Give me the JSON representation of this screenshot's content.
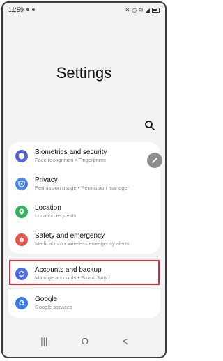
{
  "status_bar": {
    "time": "11:59"
  },
  "page": {
    "title": "Settings"
  },
  "rows": [
    {
      "title": "Biometrics and security",
      "subtitle": "Face recognition  •  Fingerprints",
      "icon": "shield-icon",
      "color": "#5563d9"
    },
    {
      "title": "Privacy",
      "subtitle": "Permission usage  •  Permission manager",
      "icon": "privacy-icon",
      "color": "#4a86e8"
    },
    {
      "title": "Location",
      "subtitle": "Location requests",
      "icon": "location-icon",
      "color": "#2fb35a"
    },
    {
      "title": "Safety and emergency",
      "subtitle": "Medical info  •  Wireless emergency alerts",
      "icon": "emergency-icon",
      "color": "#e8544a"
    },
    {
      "title": "Accounts and backup",
      "subtitle": "Manage accounts  •  Smart Switch",
      "icon": "sync-icon",
      "color": "#4a6ee0"
    },
    {
      "title": "Google",
      "subtitle": "Google services",
      "icon": "google-icon",
      "color": "#3a7be8"
    }
  ],
  "nav": {
    "recents": "|||",
    "home": "O",
    "back": "<"
  },
  "colors": {
    "highlight": "#d42a32"
  }
}
